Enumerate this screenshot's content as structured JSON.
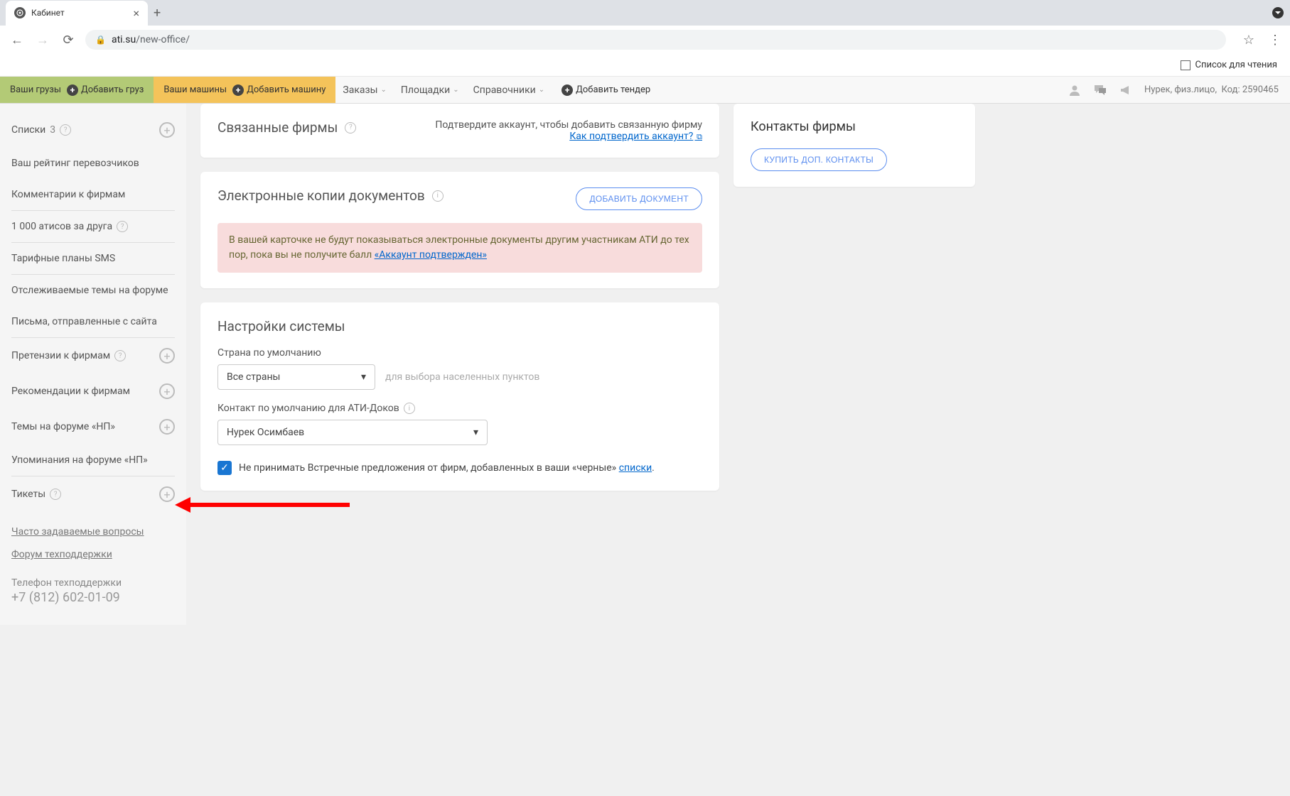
{
  "browser": {
    "tab_title": "Кабинет",
    "url_domain": "ati.su",
    "url_path": "/new-office/",
    "reading_list": "Список для чтения"
  },
  "toolbar": {
    "cargo_label": "Ваши грузы",
    "add_cargo": "Добавить груз",
    "vehicles_label": "Ваши машины",
    "add_vehicle": "Добавить машину",
    "orders": "Заказы",
    "platforms": "Площадки",
    "directories": "Справочники",
    "add_tender": "Добавить тендер",
    "user_name": "Нурек, физ.лицо,",
    "user_code": "Код: 2590465"
  },
  "sidebar": {
    "lists": "Списки",
    "lists_count": "3",
    "rating": "Ваш рейтинг перевозчиков",
    "comments": "Комментарии к фирмам",
    "atis_bonus": "1 000 атисов за друга",
    "tariff_sms": "Тарифные планы SMS",
    "forum_topics": "Отслеживаемые темы на форуме",
    "sent_letters": "Письма, отправленные с сайта",
    "claims": "Претензии к фирмам",
    "recommendations": "Рекомендации к фирмам",
    "np_topics": "Темы на форуме «НП»",
    "np_mentions": "Упоминания на форуме «НП»",
    "tickets": "Тикеты",
    "faq": "Часто задаваемые вопросы",
    "support_forum": "Форум техподдержки",
    "support_phone_label": "Телефон техподдержки",
    "support_phone": "+7 (812) 602-01-09"
  },
  "related_firms": {
    "title": "Связанные фирмы",
    "notice": "Подтвердите аккаунт, чтобы добавить связанную фирму",
    "confirm_link": "Как подтвердить аккаунт?"
  },
  "documents": {
    "title": "Электронные копии документов",
    "add_btn": "ДОБАВИТЬ ДОКУМЕНТ",
    "alert_text": "В вашей карточке не будут показываться электронные документы другим участникам АТИ до тех пор, пока вы не получите балл ",
    "alert_link": "«Аккаунт подтвержден»"
  },
  "settings": {
    "title": "Настройки системы",
    "country_label": "Страна по умолчанию",
    "country_value": "Все страны",
    "country_hint": "для выбора населенных пунктов",
    "contact_label": "Контакт по умолчанию для АТИ-Доков",
    "contact_value": "Нурек Осимбаев",
    "checkbox_label_pre": "Не принимать Встречные предложения от фирм, добавленных в ваши «черные» ",
    "checkbox_label_link": "списки",
    "checkbox_label_post": "."
  },
  "contacts_card": {
    "title": "Контакты фирмы",
    "buy_btn": "КУПИТЬ ДОП. КОНТАКТЫ"
  }
}
